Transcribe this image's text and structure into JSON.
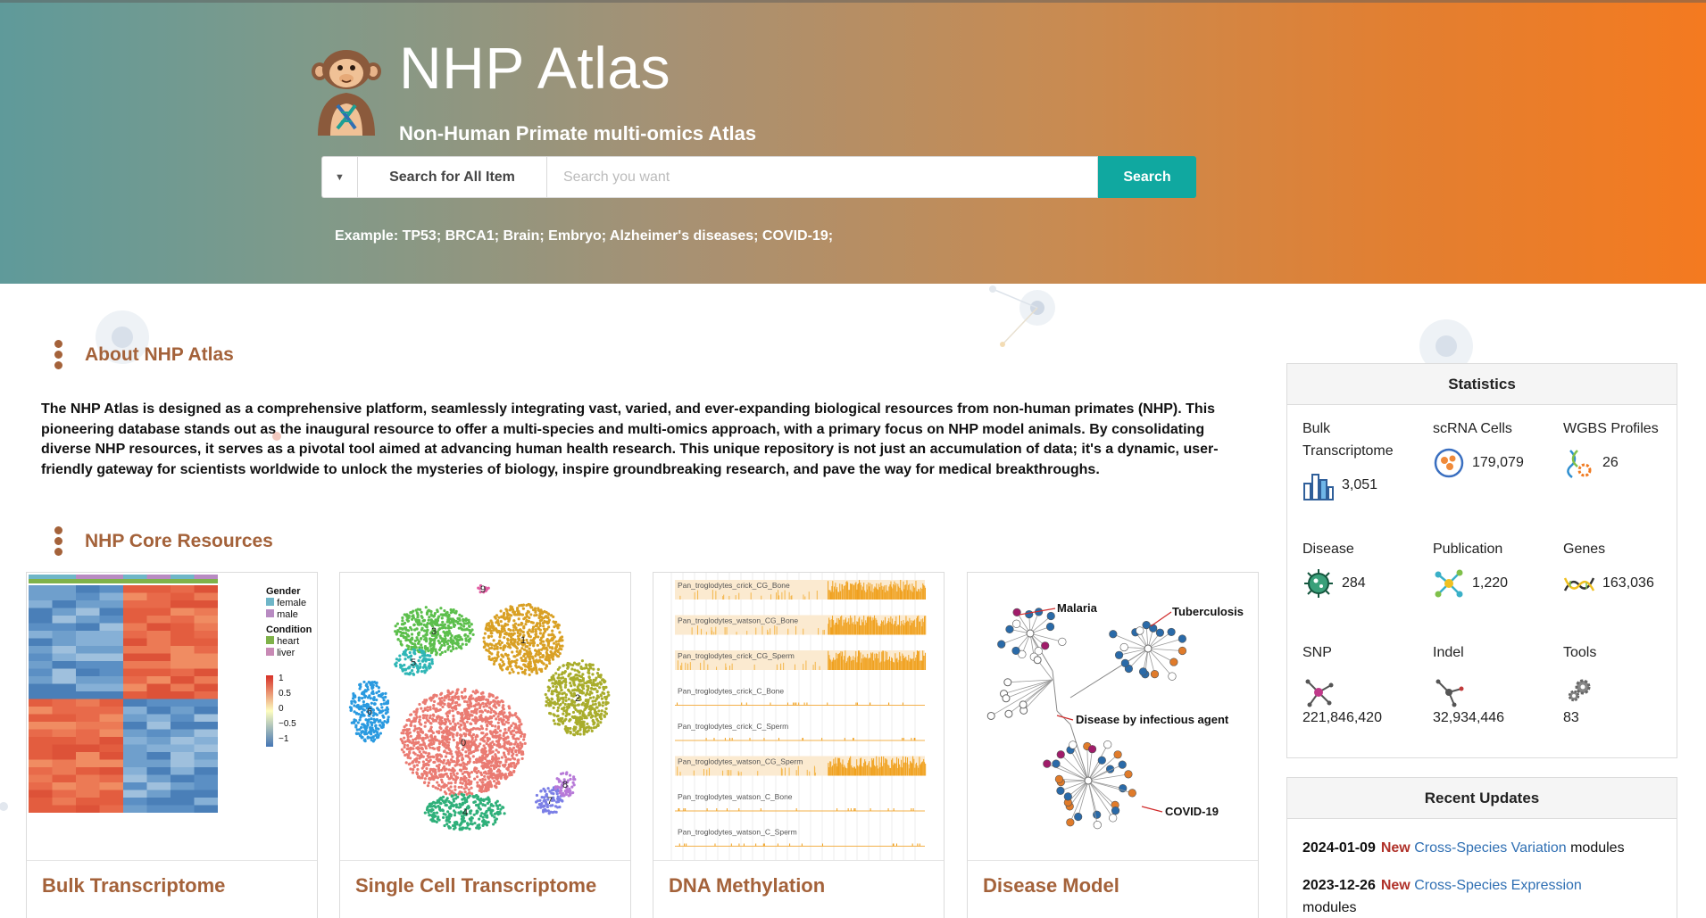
{
  "hero": {
    "title": "NHP Atlas",
    "subtitle": "Non-Human Primate multi-omics Atlas",
    "search_scope": "Search for All Item",
    "search_placeholder": "Search you want",
    "search_button": "Search",
    "example": "Example: TP53; BRCA1; Brain; Embryo; Alzheimer's diseases; COVID-19;"
  },
  "about": {
    "heading": "About NHP Atlas",
    "text": "The NHP Atlas is designed as a comprehensive platform, seamlessly integrating vast, varied, and ever-expanding biological resources from non-human primates (NHP). This pioneering database stands out as the inaugural resource to offer a multi-species and multi-omics approach, with a primary focus on NHP model animals. By consolidating diverse NHP resources, it serves as a pivotal tool aimed at advancing human health research. This unique repository is not just an accumulation of data; it's a dynamic, user-friendly gateway for scientists worldwide to unlock the mysteries of biology, inspire groundbreaking research, and pave the way for medical breakthroughs."
  },
  "core": {
    "heading": "NHP Core Resources",
    "cards": [
      {
        "title": "Bulk Transcriptome"
      },
      {
        "title": "Single Cell Transcriptome"
      },
      {
        "title": "DNA Methylation"
      },
      {
        "title": "Disease Model"
      }
    ],
    "heatmap_legend": {
      "gender": "Gender",
      "female": "female",
      "male": "male",
      "condition": "Condition",
      "heart": "heart",
      "liver": "liver",
      "scale": [
        "1",
        "0.5",
        "0",
        "−0.5",
        "−1"
      ]
    },
    "tsne_clusters": [
      "0",
      "1",
      "2",
      "3",
      "4",
      "5",
      "6",
      "7",
      "8",
      "9"
    ],
    "methylation_tracks": [
      "Pan_troglodytes_crick_CG_Bone",
      "Pan_troglodytes_watson_CG_Bone",
      "Pan_troglodytes_crick_CG_Sperm",
      "Pan_troglodytes_crick_C_Bone",
      "Pan_troglodytes_crick_C_Sperm",
      "Pan_troglodytes_watson_CG_Sperm",
      "Pan_troglodytes_watson_C_Bone",
      "Pan_troglodytes_watson_C_Sperm"
    ],
    "network_labels": {
      "malaria": "Malaria",
      "tuberculosis": "Tuberculosis",
      "infectious": "Disease by infectious agent",
      "covid": "COVID-19"
    }
  },
  "statistics": {
    "heading": "Statistics",
    "items": [
      {
        "label": "Bulk Transcriptome",
        "value": "3,051",
        "icon": "bar-chart-icon"
      },
      {
        "label": "scRNA Cells",
        "value": "179,079",
        "icon": "cells-icon"
      },
      {
        "label": "WGBS Profiles",
        "value": "26",
        "icon": "dna-gear-icon"
      },
      {
        "label": "Disease",
        "value": "284",
        "icon": "virus-icon"
      },
      {
        "label": "Publication",
        "value": "1,220",
        "icon": "network-icon"
      },
      {
        "label": "Genes",
        "value": "163,036",
        "icon": "dna-helix-icon"
      },
      {
        "label": "SNP",
        "value": "221,846,420",
        "icon": "snp-icon"
      },
      {
        "label": "Indel",
        "value": "32,934,446",
        "icon": "indel-icon"
      },
      {
        "label": "Tools",
        "value": "83",
        "icon": "gears-icon"
      }
    ]
  },
  "updates": {
    "heading": "Recent Updates",
    "items": [
      {
        "date": "2024-01-09",
        "new": "New",
        "link": "Cross-Species Variation",
        "suffix": "modules"
      },
      {
        "date": "2023-12-26",
        "new": "New",
        "link": "Cross-Species Expression",
        "suffix": "modules"
      }
    ]
  },
  "colors": {
    "accent": "#a4623a",
    "search_button": "#10a8a0",
    "hero_left": "#5f9a9a",
    "hero_right": "#f47a20",
    "link": "#2f6fb3",
    "new_tag": "#b0322a"
  }
}
